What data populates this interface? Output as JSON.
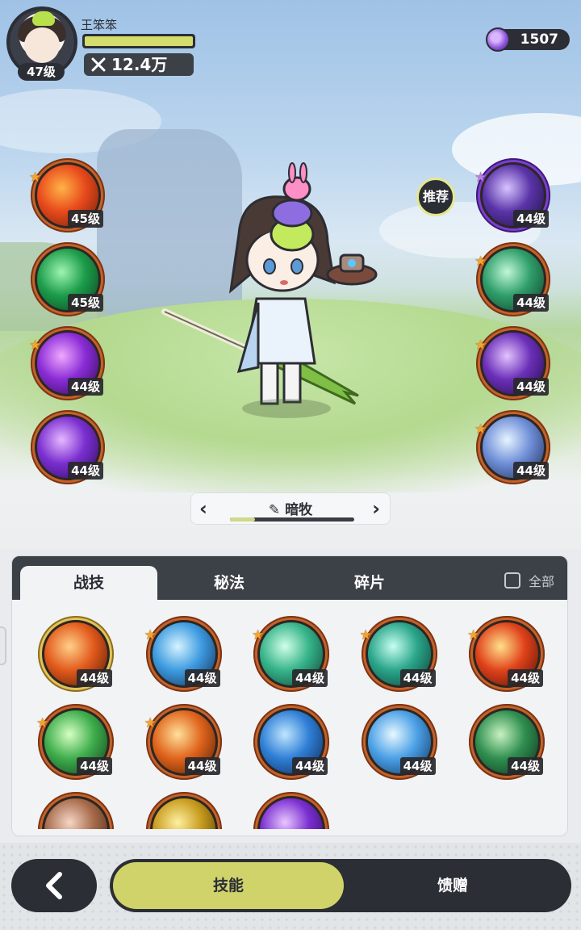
{
  "player": {
    "name": "王笨笨",
    "level": "47级",
    "power": "12.4万",
    "hp_fraction": 1.0
  },
  "currency": {
    "amount": "1507",
    "icon": "purple-gem-icon"
  },
  "recommend_label": "推荐",
  "left_skills": [
    {
      "icon": "fire-phoenix-icon",
      "level": "45级",
      "star": true
    },
    {
      "icon": "green-cross-icon",
      "level": "45级",
      "star": false
    },
    {
      "icon": "purple-eye-icon",
      "level": "44级",
      "star": true
    },
    {
      "icon": "purple-vortex-icon",
      "level": "44级",
      "star": false
    }
  ],
  "right_skills": [
    {
      "icon": "purple-shield-eye-icon",
      "level": "44级",
      "star": true
    },
    {
      "icon": "green-shield-icon",
      "level": "44级",
      "star": true
    },
    {
      "icon": "purple-fist-icon",
      "level": "44级",
      "star": true
    },
    {
      "icon": "blue-sparkle-icon",
      "level": "44级",
      "star": true
    }
  ],
  "class_selector": {
    "name": "暗牧",
    "progress": 0.2,
    "prev": "‹",
    "next": "›"
  },
  "tabs": [
    {
      "label": "战技",
      "active": true
    },
    {
      "label": "秘法",
      "active": false
    },
    {
      "label": "碎片",
      "active": false
    }
  ],
  "filter_label": "全部",
  "skill_grid": [
    {
      "icon": "fire-swirl-icon",
      "level": "44级",
      "star": false,
      "ring": "gold"
    },
    {
      "icon": "ice-crystal-icon",
      "level": "44级",
      "star": true,
      "ring": "orange"
    },
    {
      "icon": "wind-slash-icon",
      "level": "44级",
      "star": true,
      "ring": "orange"
    },
    {
      "icon": "green-whirlwind-icon",
      "level": "44级",
      "star": true,
      "ring": "orange"
    },
    {
      "icon": "flame-burst-icon",
      "level": "44级",
      "star": true,
      "ring": "orange"
    },
    {
      "icon": "green-wind-blade-icon",
      "level": "44级",
      "star": true,
      "ring": "orange"
    },
    {
      "icon": "fire-orb-icon",
      "level": "44级",
      "star": true,
      "ring": "orange"
    },
    {
      "icon": "water-wave-icon",
      "level": "44级",
      "star": false,
      "ring": "orange"
    },
    {
      "icon": "ice-burst-icon",
      "level": "44级",
      "star": false,
      "ring": "orange"
    },
    {
      "icon": "thorn-vine-icon",
      "level": "44级",
      "star": false,
      "ring": "orange"
    },
    {
      "icon": "stone-fragment-icon",
      "level": "",
      "star": false,
      "ring": "orange"
    },
    {
      "icon": "golden-cross-icon",
      "level": "",
      "star": false,
      "ring": "orange"
    },
    {
      "icon": "purple-flame-icon",
      "level": "",
      "star": false,
      "ring": "orange"
    }
  ],
  "bottom_nav": {
    "back_icon": "chevron-left-icon",
    "options": [
      {
        "label": "技能",
        "active": true
      },
      {
        "label": "馈赠",
        "active": false
      }
    ]
  },
  "colors": {
    "dark": "#2b2e35",
    "accent_yellow": "#cfd36a",
    "orb_orange": "#c3622a",
    "orb_purple": "#7b3fd0",
    "orb_gold": "#e2c35a",
    "star": "#f3a531"
  }
}
